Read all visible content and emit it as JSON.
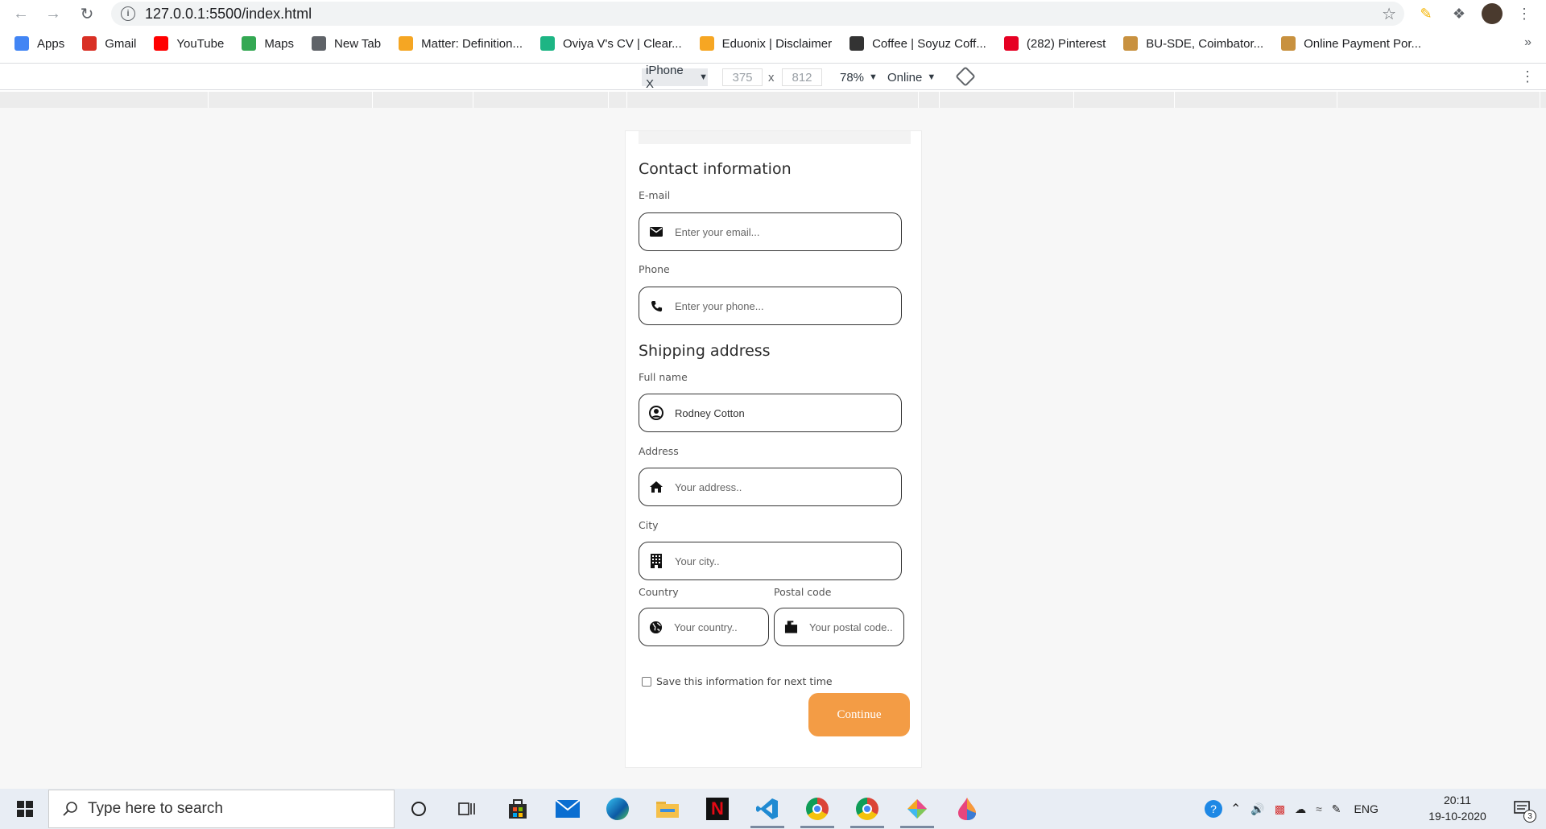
{
  "browser": {
    "url": "127.0.0.1:5500/index.html"
  },
  "bookmarks": [
    {
      "label": "Apps",
      "icon": "apps-grid-icon",
      "color": "#4285f4"
    },
    {
      "label": "Gmail",
      "icon": "gmail-icon",
      "color": "#d93025"
    },
    {
      "label": "YouTube",
      "icon": "youtube-icon",
      "color": "#ff0000"
    },
    {
      "label": "Maps",
      "icon": "maps-icon",
      "color": "#34a853"
    },
    {
      "label": "New Tab",
      "icon": "globe-icon",
      "color": "#5f6368"
    },
    {
      "label": "Matter: Definition...",
      "icon": "matter-icon",
      "color": "#f5a623"
    },
    {
      "label": "Oviya V's CV | Clear...",
      "icon": "clearcv-icon",
      "color": "#1db584"
    },
    {
      "label": "Eduonix | Disclaimer",
      "icon": "eduonix-icon",
      "color": "#f6a623"
    },
    {
      "label": "Coffee | Soyuz Coff...",
      "icon": "coffee-icon",
      "color": "#333333"
    },
    {
      "label": "(282) Pinterest",
      "icon": "pinterest-icon",
      "color": "#e60023"
    },
    {
      "label": "BU-SDE, Coimbator...",
      "icon": "person-icon",
      "color": "#c8913f"
    },
    {
      "label": "Online Payment Por...",
      "icon": "person-icon",
      "color": "#c8913f"
    }
  ],
  "bookmarks_more": "»",
  "devtools": {
    "device": "iPhone X",
    "width": "375",
    "height": "812",
    "times": "x",
    "zoom": "78%",
    "network": "Online"
  },
  "form": {
    "contact_title": "Contact information",
    "email_label": "E-mail",
    "email_placeholder": "Enter your email...",
    "phone_label": "Phone",
    "phone_placeholder": "Enter your phone...",
    "shipping_title": "Shipping address",
    "fullname_label": "Full name",
    "fullname_value": "Rodney Cotton",
    "address_label": "Address",
    "address_placeholder": "Your address..",
    "city_label": "City",
    "city_placeholder": "Your city..",
    "country_label": "Country",
    "country_placeholder": "Your country..",
    "postal_label": "Postal code",
    "postal_placeholder": "Your postal code..",
    "save_label": "Save this information for next time",
    "continue_label": "Continue",
    "accent_color": "#f39c45"
  },
  "taskbar": {
    "search_placeholder": "Type here to search",
    "lang": "ENG",
    "time": "20:11",
    "date": "19-10-2020",
    "notifications": "3"
  }
}
